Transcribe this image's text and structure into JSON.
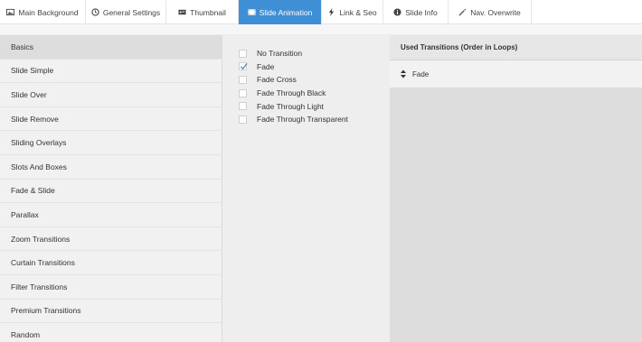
{
  "tabs": [
    {
      "label": "Main Background",
      "icon": "image-icon",
      "active": false
    },
    {
      "label": "General Settings",
      "icon": "history-icon",
      "active": false
    },
    {
      "label": "Thumbnail",
      "icon": "thumbnail-icon",
      "active": false
    },
    {
      "label": "Slide Animation",
      "icon": "film-icon",
      "active": true
    },
    {
      "label": "Link & Seo",
      "icon": "bolt-icon",
      "active": false
    },
    {
      "label": "Slide Info",
      "icon": "info-icon",
      "active": false
    },
    {
      "label": "Nav. Overwrite",
      "icon": "magic-wand-icon",
      "active": false
    }
  ],
  "sidebar": {
    "items": [
      {
        "label": "Basics",
        "active": true
      },
      {
        "label": "Slide Simple"
      },
      {
        "label": "Slide Over"
      },
      {
        "label": "Slide Remove"
      },
      {
        "label": "Sliding Overlays"
      },
      {
        "label": "Slots And Boxes"
      },
      {
        "label": "Fade & Slide"
      },
      {
        "label": "Parallax"
      },
      {
        "label": "Zoom Transitions"
      },
      {
        "label": "Curtain Transitions"
      },
      {
        "label": "Filter Transitions"
      },
      {
        "label": "Premium Transitions"
      },
      {
        "label": "Random"
      }
    ]
  },
  "transitions": [
    {
      "label": "No Transition",
      "checked": false
    },
    {
      "label": "Fade",
      "checked": true
    },
    {
      "label": "Fade Cross",
      "checked": false
    },
    {
      "label": "Fade Through Black",
      "checked": false
    },
    {
      "label": "Fade Through Light",
      "checked": false
    },
    {
      "label": "Fade Through Transparent",
      "checked": false
    }
  ],
  "used_panel": {
    "title": "Used Transitions (Order in Loops)",
    "items": [
      {
        "label": "Fade",
        "icon": "sort-icon"
      }
    ]
  },
  "colors": {
    "accent": "#3e8fd5"
  }
}
